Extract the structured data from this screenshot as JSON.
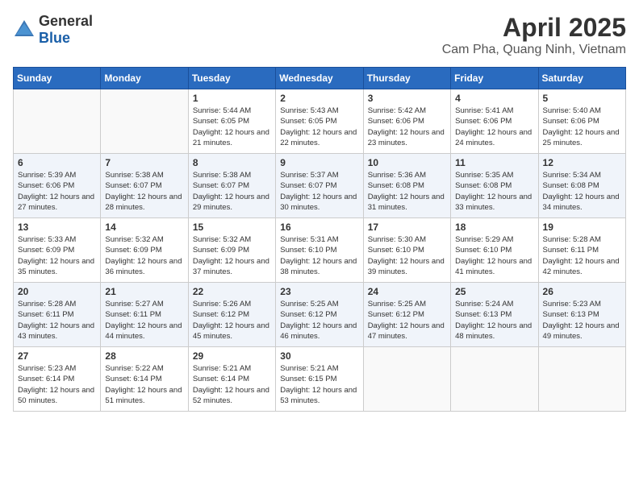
{
  "header": {
    "logo_general": "General",
    "logo_blue": "Blue",
    "title": "April 2025",
    "subtitle": "Cam Pha, Quang Ninh, Vietnam"
  },
  "calendar": {
    "days_of_week": [
      "Sunday",
      "Monday",
      "Tuesday",
      "Wednesday",
      "Thursday",
      "Friday",
      "Saturday"
    ],
    "weeks": [
      [
        {
          "day": "",
          "sunrise": "",
          "sunset": "",
          "daylight": "",
          "empty": true
        },
        {
          "day": "",
          "sunrise": "",
          "sunset": "",
          "daylight": "",
          "empty": true
        },
        {
          "day": "1",
          "sunrise": "Sunrise: 5:44 AM",
          "sunset": "Sunset: 6:05 PM",
          "daylight": "Daylight: 12 hours and 21 minutes."
        },
        {
          "day": "2",
          "sunrise": "Sunrise: 5:43 AM",
          "sunset": "Sunset: 6:05 PM",
          "daylight": "Daylight: 12 hours and 22 minutes."
        },
        {
          "day": "3",
          "sunrise": "Sunrise: 5:42 AM",
          "sunset": "Sunset: 6:06 PM",
          "daylight": "Daylight: 12 hours and 23 minutes."
        },
        {
          "day": "4",
          "sunrise": "Sunrise: 5:41 AM",
          "sunset": "Sunset: 6:06 PM",
          "daylight": "Daylight: 12 hours and 24 minutes."
        },
        {
          "day": "5",
          "sunrise": "Sunrise: 5:40 AM",
          "sunset": "Sunset: 6:06 PM",
          "daylight": "Daylight: 12 hours and 25 minutes."
        }
      ],
      [
        {
          "day": "6",
          "sunrise": "Sunrise: 5:39 AM",
          "sunset": "Sunset: 6:06 PM",
          "daylight": "Daylight: 12 hours and 27 minutes."
        },
        {
          "day": "7",
          "sunrise": "Sunrise: 5:38 AM",
          "sunset": "Sunset: 6:07 PM",
          "daylight": "Daylight: 12 hours and 28 minutes."
        },
        {
          "day": "8",
          "sunrise": "Sunrise: 5:38 AM",
          "sunset": "Sunset: 6:07 PM",
          "daylight": "Daylight: 12 hours and 29 minutes."
        },
        {
          "day": "9",
          "sunrise": "Sunrise: 5:37 AM",
          "sunset": "Sunset: 6:07 PM",
          "daylight": "Daylight: 12 hours and 30 minutes."
        },
        {
          "day": "10",
          "sunrise": "Sunrise: 5:36 AM",
          "sunset": "Sunset: 6:08 PM",
          "daylight": "Daylight: 12 hours and 31 minutes."
        },
        {
          "day": "11",
          "sunrise": "Sunrise: 5:35 AM",
          "sunset": "Sunset: 6:08 PM",
          "daylight": "Daylight: 12 hours and 33 minutes."
        },
        {
          "day": "12",
          "sunrise": "Sunrise: 5:34 AM",
          "sunset": "Sunset: 6:08 PM",
          "daylight": "Daylight: 12 hours and 34 minutes."
        }
      ],
      [
        {
          "day": "13",
          "sunrise": "Sunrise: 5:33 AM",
          "sunset": "Sunset: 6:09 PM",
          "daylight": "Daylight: 12 hours and 35 minutes."
        },
        {
          "day": "14",
          "sunrise": "Sunrise: 5:32 AM",
          "sunset": "Sunset: 6:09 PM",
          "daylight": "Daylight: 12 hours and 36 minutes."
        },
        {
          "day": "15",
          "sunrise": "Sunrise: 5:32 AM",
          "sunset": "Sunset: 6:09 PM",
          "daylight": "Daylight: 12 hours and 37 minutes."
        },
        {
          "day": "16",
          "sunrise": "Sunrise: 5:31 AM",
          "sunset": "Sunset: 6:10 PM",
          "daylight": "Daylight: 12 hours and 38 minutes."
        },
        {
          "day": "17",
          "sunrise": "Sunrise: 5:30 AM",
          "sunset": "Sunset: 6:10 PM",
          "daylight": "Daylight: 12 hours and 39 minutes."
        },
        {
          "day": "18",
          "sunrise": "Sunrise: 5:29 AM",
          "sunset": "Sunset: 6:10 PM",
          "daylight": "Daylight: 12 hours and 41 minutes."
        },
        {
          "day": "19",
          "sunrise": "Sunrise: 5:28 AM",
          "sunset": "Sunset: 6:11 PM",
          "daylight": "Daylight: 12 hours and 42 minutes."
        }
      ],
      [
        {
          "day": "20",
          "sunrise": "Sunrise: 5:28 AM",
          "sunset": "Sunset: 6:11 PM",
          "daylight": "Daylight: 12 hours and 43 minutes."
        },
        {
          "day": "21",
          "sunrise": "Sunrise: 5:27 AM",
          "sunset": "Sunset: 6:11 PM",
          "daylight": "Daylight: 12 hours and 44 minutes."
        },
        {
          "day": "22",
          "sunrise": "Sunrise: 5:26 AM",
          "sunset": "Sunset: 6:12 PM",
          "daylight": "Daylight: 12 hours and 45 minutes."
        },
        {
          "day": "23",
          "sunrise": "Sunrise: 5:25 AM",
          "sunset": "Sunset: 6:12 PM",
          "daylight": "Daylight: 12 hours and 46 minutes."
        },
        {
          "day": "24",
          "sunrise": "Sunrise: 5:25 AM",
          "sunset": "Sunset: 6:12 PM",
          "daylight": "Daylight: 12 hours and 47 minutes."
        },
        {
          "day": "25",
          "sunrise": "Sunrise: 5:24 AM",
          "sunset": "Sunset: 6:13 PM",
          "daylight": "Daylight: 12 hours and 48 minutes."
        },
        {
          "day": "26",
          "sunrise": "Sunrise: 5:23 AM",
          "sunset": "Sunset: 6:13 PM",
          "daylight": "Daylight: 12 hours and 49 minutes."
        }
      ],
      [
        {
          "day": "27",
          "sunrise": "Sunrise: 5:23 AM",
          "sunset": "Sunset: 6:14 PM",
          "daylight": "Daylight: 12 hours and 50 minutes."
        },
        {
          "day": "28",
          "sunrise": "Sunrise: 5:22 AM",
          "sunset": "Sunset: 6:14 PM",
          "daylight": "Daylight: 12 hours and 51 minutes."
        },
        {
          "day": "29",
          "sunrise": "Sunrise: 5:21 AM",
          "sunset": "Sunset: 6:14 PM",
          "daylight": "Daylight: 12 hours and 52 minutes."
        },
        {
          "day": "30",
          "sunrise": "Sunrise: 5:21 AM",
          "sunset": "Sunset: 6:15 PM",
          "daylight": "Daylight: 12 hours and 53 minutes."
        },
        {
          "day": "",
          "sunrise": "",
          "sunset": "",
          "daylight": "",
          "empty": true
        },
        {
          "day": "",
          "sunrise": "",
          "sunset": "",
          "daylight": "",
          "empty": true
        },
        {
          "day": "",
          "sunrise": "",
          "sunset": "",
          "daylight": "",
          "empty": true
        }
      ]
    ]
  }
}
